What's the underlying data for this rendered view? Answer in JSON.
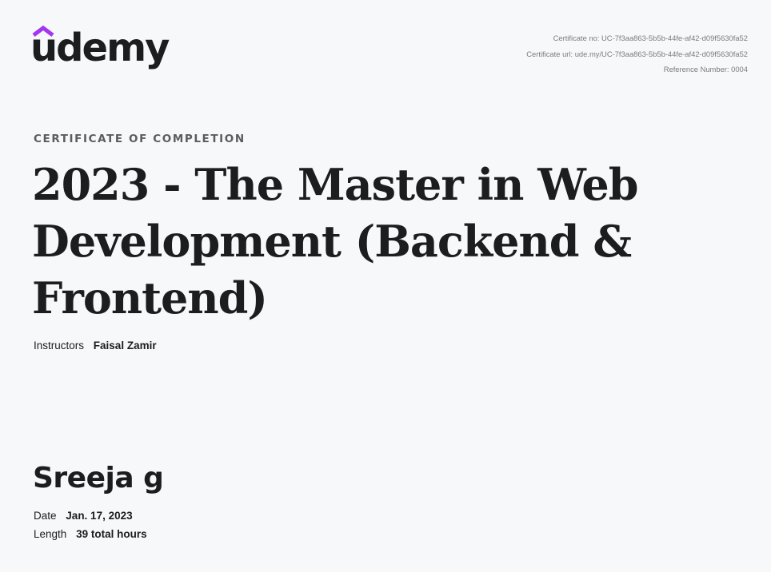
{
  "brand": {
    "logo_text": "udemy",
    "accent_color": "#a435f0"
  },
  "meta": {
    "certificate_no": "Certificate no: UC-7f3aa863-5b5b-44fe-af42-d09f5630fa52",
    "certificate_url": "Certificate url: ude.my/UC-7f3aa863-5b5b-44fe-af42-d09f5630fa52",
    "reference_number": "Reference Number: 0004"
  },
  "certificate": {
    "kicker": "CERTIFICATE OF COMPLETION",
    "course_title": "2023 - The Master in Web Development (Backend & Frontend)",
    "instructors_label": "Instructors",
    "instructors_value": "Faisal Zamir",
    "student_name": "Sreeja g",
    "date_label": "Date",
    "date_value": "Jan. 17, 2023",
    "length_label": "Length",
    "length_value": "39 total hours"
  }
}
